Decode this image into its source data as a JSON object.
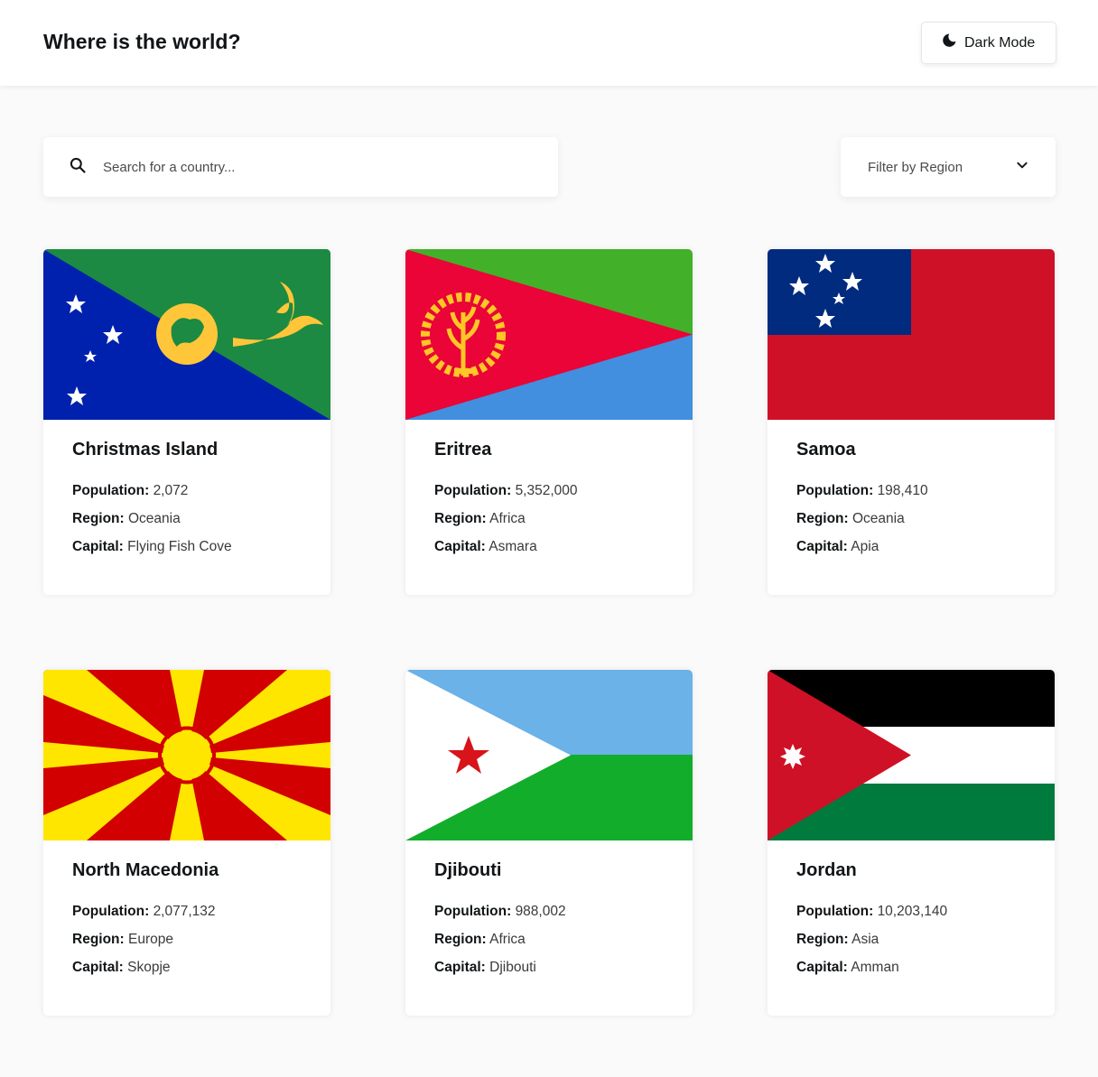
{
  "header": {
    "title": "Where is the world?",
    "dark_mode_label": "Dark Mode"
  },
  "search": {
    "placeholder": "Search for a country...",
    "icon": "search-icon"
  },
  "filter": {
    "label": "Filter by Region",
    "icon": "chevron-down-icon"
  },
  "labels": {
    "population": "Population:",
    "region": "Region:",
    "capital": "Capital:"
  },
  "countries": [
    {
      "name": "Christmas Island",
      "population": "2,072",
      "region": "Oceania",
      "capital": "Flying Fish Cove",
      "flag": "christmas-island-flag"
    },
    {
      "name": "Eritrea",
      "population": "5,352,000",
      "region": "Africa",
      "capital": "Asmara",
      "flag": "eritrea-flag"
    },
    {
      "name": "Samoa",
      "population": "198,410",
      "region": "Oceania",
      "capital": "Apia",
      "flag": "samoa-flag"
    },
    {
      "name": "North Macedonia",
      "population": "2,077,132",
      "region": "Europe",
      "capital": "Skopje",
      "flag": "north-macedonia-flag"
    },
    {
      "name": "Djibouti",
      "population": "988,002",
      "region": "Africa",
      "capital": "Djibouti",
      "flag": "djibouti-flag"
    },
    {
      "name": "Jordan",
      "population": "10,203,140",
      "region": "Asia",
      "capital": "Amman",
      "flag": "jordan-flag"
    }
  ],
  "colors": {
    "background": "#fafafa",
    "card": "#ffffff",
    "text": "#111517"
  }
}
